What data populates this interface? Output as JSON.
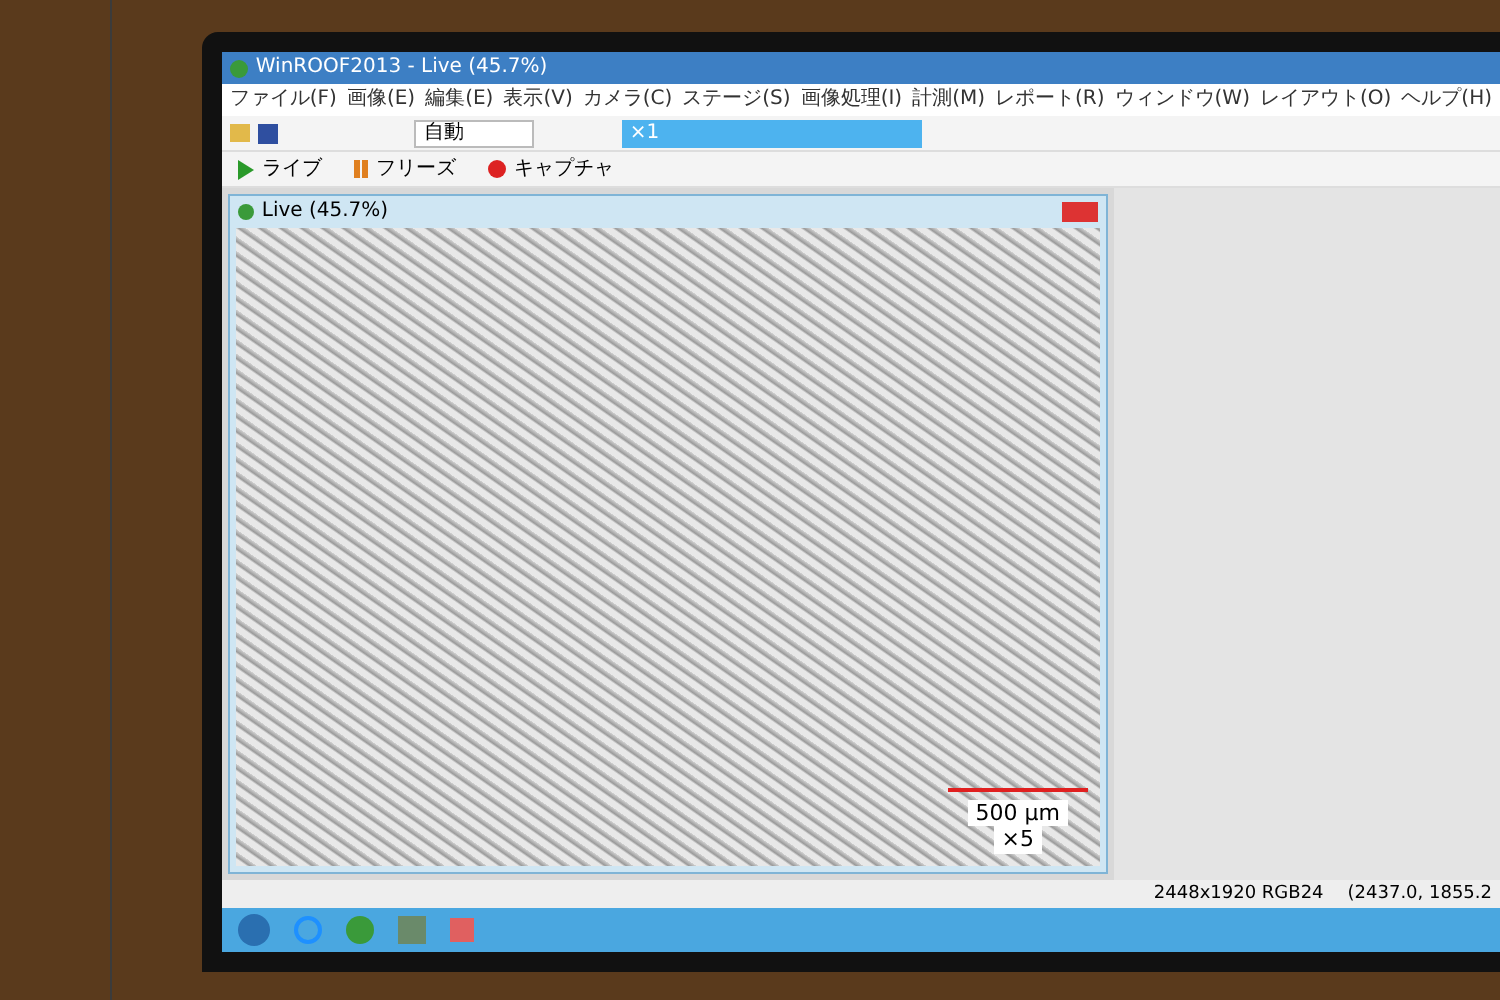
{
  "app_window": {
    "title": "WinROOF2013 - Live (45.7%)"
  },
  "menu": [
    "ファイル(F)",
    "画像(E)",
    "編集(E)",
    "表示(V)",
    "カメラ(C)",
    "ステージ(S)",
    "画像処理(I)",
    "計測(M)",
    "レポート(R)",
    "ウィンドウ(W)",
    "レイアウト(O)",
    "ヘルプ(H)"
  ],
  "toolbar": {
    "zoom_mode": "自動",
    "magnification": "×1"
  },
  "live_buttons": [
    {
      "label": "ライブ",
      "kind": "play"
    },
    {
      "label": "フリーズ",
      "kind": "pause"
    },
    {
      "label": "キャプチャ",
      "kind": "record"
    }
  ],
  "image_window": {
    "title": "Live (45.7%)",
    "scale_bar": {
      "length": "500 μm",
      "objective": "×5"
    }
  },
  "status_bar": {
    "size": "2448x1920 RGB24",
    "position": "(2437.0, 1855.2"
  }
}
